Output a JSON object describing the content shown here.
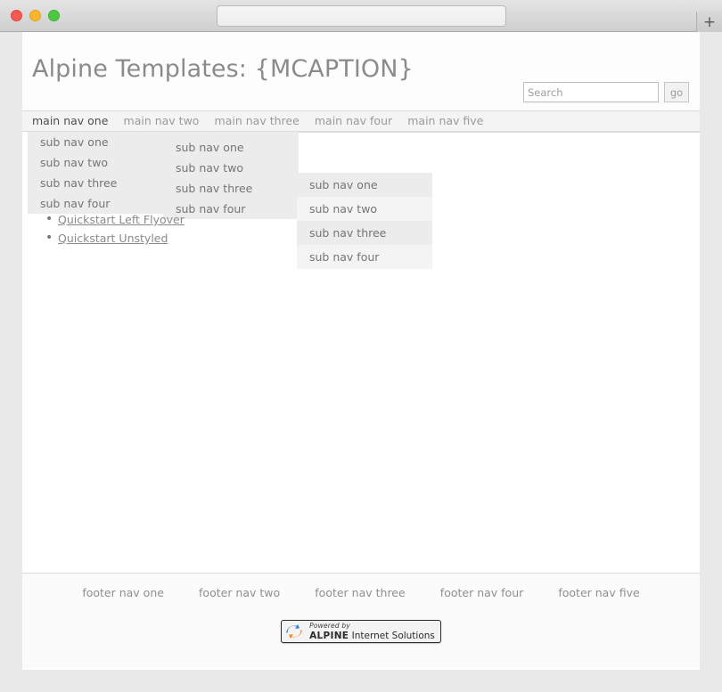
{
  "browser": {
    "traffic_lights": [
      {
        "name": "close",
        "color": "#f45a52"
      },
      {
        "name": "minimize",
        "color": "#f8b62a"
      },
      {
        "name": "zoom",
        "color": "#4cc842"
      }
    ],
    "tab_title": "",
    "new_tab_label": "+"
  },
  "header": {
    "title": "Alpine Templates: {MCAPTION}"
  },
  "search": {
    "value": "",
    "placeholder": "Search",
    "button_label": "go"
  },
  "main_nav": {
    "items": [
      {
        "label": "main nav one",
        "active": true
      },
      {
        "label": "main nav two",
        "active": false
      },
      {
        "label": "main nav three",
        "active": false
      },
      {
        "label": "main nav four",
        "active": false
      },
      {
        "label": "main nav five",
        "active": false
      }
    ]
  },
  "flyovers": [
    {
      "id": "flyover-1",
      "items": [
        "sub nav one",
        "sub nav two",
        "sub nav three",
        "sub nav four"
      ]
    },
    {
      "id": "flyover-2",
      "items": [
        "sub nav one",
        "sub nav two",
        "sub nav three",
        "sub nav four"
      ]
    },
    {
      "id": "flyover-3",
      "items": [
        "sub nav one",
        "sub nav two",
        "sub nav three",
        "sub nav four"
      ]
    }
  ],
  "quickstart_links": [
    "Quickstart Left Flyover",
    "Quickstart Unstyled"
  ],
  "footer_nav": {
    "items": [
      "footer nav one",
      "footer nav two",
      "footer nav three",
      "footer nav four",
      "footer nav five"
    ]
  },
  "badge": {
    "powered_by": "Powered by",
    "brand": "ALPINE",
    "brand_suffix": " Internet Solutions"
  },
  "colors": {
    "page_background": "#ffffff",
    "chrome_background": "#e9e9e9",
    "nav_background": "#f4f4f4",
    "flyover_background": "#ececec",
    "flyover_alt_background": "#f4f4f4",
    "text_muted": "#9a9a9a",
    "text_active": "#4f4f4f",
    "title_color": "#8b8b8b",
    "link_color": "#8a8a8a"
  }
}
